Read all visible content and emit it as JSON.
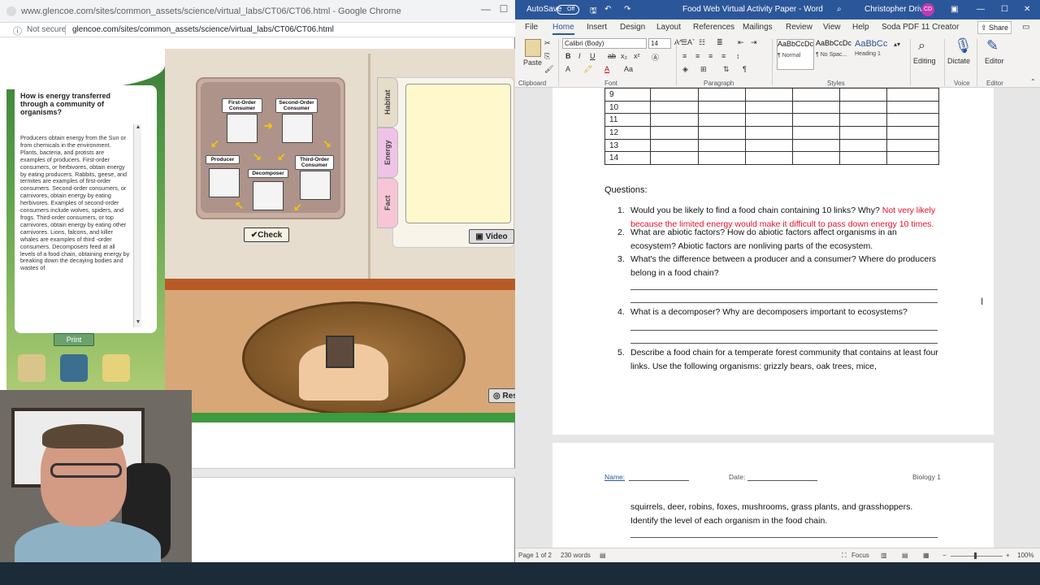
{
  "chrome": {
    "title": "www.glencoe.com/sites/common_assets/science/virtual_labs/CT06/CT06.html - Google Chrome",
    "minimize": "—",
    "restore": "☐",
    "not_secure": "Not secure",
    "url": "glencoe.com/sites/common_assets/science/virtual_labs/CT06/CT06.html"
  },
  "lab": {
    "question": "How is energy transferred through a community of organisms?",
    "body_text": "Producers obtain energy from the Sun or from chemicals in the environment. Plants, bacteria, and protists are examples of producers. First-order consumers, or herbivores, obtain energy by eating producers. Rabbits, geese, and termites are examples of first-order consumers. Second-order consumers, or carnivores, obtain energy by eating herbivores. Examples of second-order consumers include wolves, spiders, and frogs. Third-order consumers, or top carnivores, obtain energy by eating other carnivores. Lions, falcons, and killer whales are examples of third -order consumers. Decomposers feed at all levels of a food chain, obtaining energy by breaking down the decaying bodies and wastes of",
    "print_label": "Print",
    "labels": {
      "first_order": "First-Order Consumer",
      "second_order": "Second-Order Consumer",
      "producer": "Producer",
      "decomposer": "Decomposer",
      "third_order": "Third-Order Consumer"
    },
    "check_label": "✔Check",
    "tabs": [
      "Habitat",
      "Energy",
      "Fact"
    ],
    "video_label": "Video",
    "reset_label": "Res"
  },
  "word": {
    "autosave_label": "AutoSave",
    "autosave_state": "Off",
    "doc_title": "Food Web Virtual Activity Paper  -  Word",
    "user_name": "Christopher Driver",
    "user_initials": "CD",
    "menu": [
      "File",
      "Home",
      "Insert",
      "Design",
      "Layout",
      "References",
      "Mailings",
      "Review",
      "View",
      "Help",
      "Soda PDF 11 Creator"
    ],
    "share_label": "Share",
    "ribbon": {
      "paste": "Paste",
      "clipboard": "Clipboard",
      "font_name": "Calibri (Body)",
      "font_size": "14",
      "font": "Font",
      "paragraph": "Paragraph",
      "styles_label": "Styles",
      "styles": [
        {
          "preview": "AaBbCcDc",
          "name": "¶ Normal"
        },
        {
          "preview": "AaBbCcDc",
          "name": "¶ No Spac..."
        },
        {
          "preview": "AaBbCc",
          "name": "Heading 1"
        }
      ],
      "editing": "Editing",
      "dictate": "Dictate",
      "voice": "Voice",
      "editor": "Editor",
      "editor_group": "Editor"
    },
    "table_rows": [
      "9",
      "10",
      "11",
      "12",
      "13",
      "14"
    ],
    "questions_heading": "Questions:",
    "questions": [
      {
        "num": "1.",
        "text": "Would you be likely to find a food chain containing 10 links? Why?",
        "answer": "Not very likely because the limited energy would make it difficult to pass down energy 10 times."
      },
      {
        "num": "2.",
        "text": "What are abiotic factors? How do abiotic factors affect organisms in an ecosystem? Abiotic factors are nonliving parts of the ecosystem.",
        "answer": ""
      },
      {
        "num": "3.",
        "text": "What's the difference between a producer and a consumer? Where do producers belong in a food chain?",
        "answer": ""
      },
      {
        "num": "4.",
        "text": "What is a decomposer? Why are decomposers important to ecosystems?",
        "answer": ""
      },
      {
        "num": "5.",
        "text": "Describe a food chain for a temperate forest community that contains at least four links. Use the following organisms: grizzly bears, oak trees, mice,",
        "answer": ""
      }
    ],
    "page2": {
      "name_label": "Name:",
      "date_label": "Date:",
      "class_label": "Biology 1",
      "continued_text": "squirrels, deer, robins, foxes, mushrooms, grass plants, and grasshoppers. Identify the level of each organism in the food chain."
    },
    "status": {
      "page": "Page 1 of 2",
      "words": "230 words",
      "focus": "Focus",
      "zoom": "100%"
    }
  }
}
